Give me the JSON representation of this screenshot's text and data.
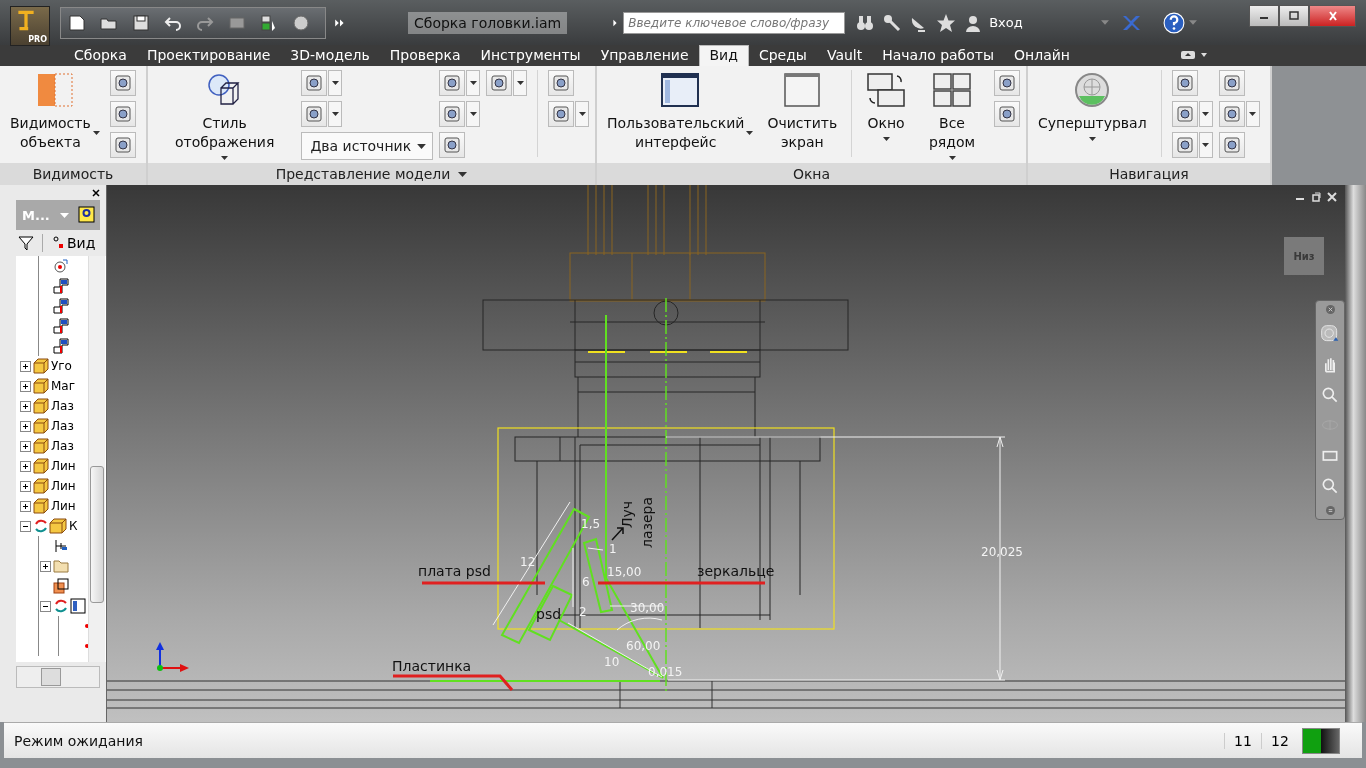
{
  "title_bar": {
    "app_badge": "PRO",
    "document_title": "Сборка головки.iam",
    "search": {
      "placeholder": "Введите ключевое слово/фразу"
    },
    "sign_in": "Вход"
  },
  "tabs": [
    {
      "label": "Сборка",
      "selected": false
    },
    {
      "label": "Проектирование",
      "selected": false
    },
    {
      "label": "3D-модель",
      "selected": false
    },
    {
      "label": "Проверка",
      "selected": false
    },
    {
      "label": "Инструменты",
      "selected": false
    },
    {
      "label": "Управление",
      "selected": false
    },
    {
      "label": "Вид",
      "selected": true
    },
    {
      "label": "Среды",
      "selected": false
    },
    {
      "label": "Vault",
      "selected": false
    },
    {
      "label": "Начало работы",
      "selected": false
    },
    {
      "label": "Онлайн",
      "selected": false
    }
  ],
  "ribbon": {
    "panels": [
      {
        "title": "Видимость",
        "menu": false,
        "large_buttons": [
          {
            "label": "Видимость\nобъекта",
            "dropdown": true
          }
        ]
      },
      {
        "title": "Представление модели",
        "menu": true,
        "large_buttons": [
          {
            "label": "Стиль отображения",
            "dropdown": true
          }
        ],
        "combo": "Два источник"
      },
      {
        "title": "Окна",
        "menu": false,
        "large_buttons": [
          {
            "label": "Пользовательский\nинтерфейс",
            "dropdown": true
          },
          {
            "label": "Очистить\nэкран",
            "dropdown": false
          },
          {
            "label": "Окно",
            "dropdown": true
          },
          {
            "label": "Все рядом",
            "dropdown": true
          }
        ]
      },
      {
        "title": "Навигация",
        "menu": false,
        "large_buttons": [
          {
            "label": "Суперштурвал",
            "dropdown": true
          }
        ]
      }
    ]
  },
  "browser": {
    "title": "М...",
    "toolbar_label": "Вид",
    "tree": [
      {
        "kind": "continued",
        "children": [
          {
            "kind": "work-point"
          },
          {
            "kind": "constraint"
          },
          {
            "kind": "constraint"
          },
          {
            "kind": "constraint"
          },
          {
            "kind": "constraint"
          }
        ]
      },
      {
        "kind": "part",
        "label": "Уго",
        "expanded": false
      },
      {
        "kind": "part",
        "label": "Маг",
        "expanded": false
      },
      {
        "kind": "part",
        "label": "Лаз",
        "expanded": false
      },
      {
        "kind": "part",
        "label": "Лаз",
        "expanded": false
      },
      {
        "kind": "part",
        "label": "Лаз",
        "expanded": false
      },
      {
        "kind": "part",
        "label": "Лин",
        "expanded": false
      },
      {
        "kind": "part",
        "label": "Лин",
        "expanded": false
      },
      {
        "kind": "part",
        "label": "Лин",
        "expanded": false
      },
      {
        "kind": "adaptive-part",
        "label": "К",
        "expanded": true,
        "children": [
          {
            "kind": "origin"
          },
          {
            "kind": "folder",
            "expanded": false
          },
          {
            "kind": "derived"
          },
          {
            "kind": "adaptive-joint",
            "expanded": true,
            "children": [
              {
                "kind": "mark"
              },
              {
                "kind": "mark"
              }
            ]
          }
        ]
      }
    ]
  },
  "canvas": {
    "view_cube": "Низ",
    "annotations": [
      {
        "kind": "note",
        "text": "плата psd"
      },
      {
        "kind": "note",
        "text": "зеркальце"
      },
      {
        "kind": "note",
        "text": "Пластинка"
      },
      {
        "kind": "vertical-note",
        "text": "Луч"
      },
      {
        "kind": "vertical-note",
        "text": "лазера"
      },
      {
        "kind": "note",
        "text": "psd"
      },
      {
        "kind": "dimension",
        "text": "1,5"
      },
      {
        "kind": "dimension",
        "text": "12"
      },
      {
        "kind": "dimension",
        "text": "1"
      },
      {
        "kind": "dimension",
        "text": "15,00"
      },
      {
        "kind": "dimension",
        "text": "6"
      },
      {
        "kind": "dimension",
        "text": "2"
      },
      {
        "kind": "dimension",
        "text": "30,00"
      },
      {
        "kind": "dimension",
        "text": "60,00"
      },
      {
        "kind": "dimension",
        "text": "10"
      },
      {
        "kind": "dimension",
        "text": "0,015"
      },
      {
        "kind": "dimension",
        "text": "20,025"
      }
    ]
  },
  "status_bar": {
    "message": "Режим ожидания",
    "cells": [
      "11",
      "12"
    ]
  }
}
